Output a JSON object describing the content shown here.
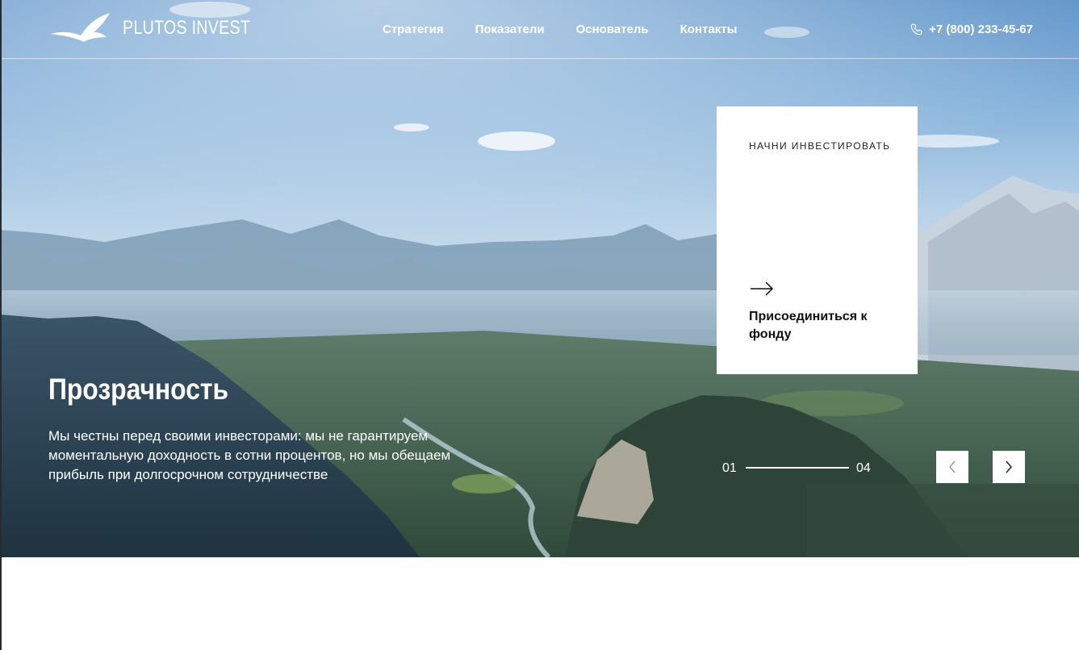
{
  "header": {
    "brand": "PLUTOS INVEST",
    "nav": [
      "Стратегия",
      "Показатели",
      "Основатель",
      "Контакты"
    ],
    "phone": "+7 (800) 233-45-67"
  },
  "card": {
    "eyebrow": "НАЧНИ ИНВЕСТИРОВАТЬ",
    "title": "Присоединиться к фонду"
  },
  "slide": {
    "title": "Прозрачность",
    "text": "Мы честны перед своими инвесторами: мы не гарантируем моментальную доходность в сотни процентов, но мы обещаем прибыль при долгосрочном сотрудничестве"
  },
  "pager": {
    "current": "01",
    "total": "04"
  },
  "icons": {
    "logo": "eagle-icon",
    "phone": "phone-icon",
    "card_arrow": "arrow-right-icon",
    "prev": "chevron-left-icon",
    "next": "chevron-right-icon"
  },
  "colors": {
    "sky": "#86b2da",
    "card_bg": "#ffffff",
    "text_light": "#ffffff",
    "text_dark": "#111111"
  }
}
